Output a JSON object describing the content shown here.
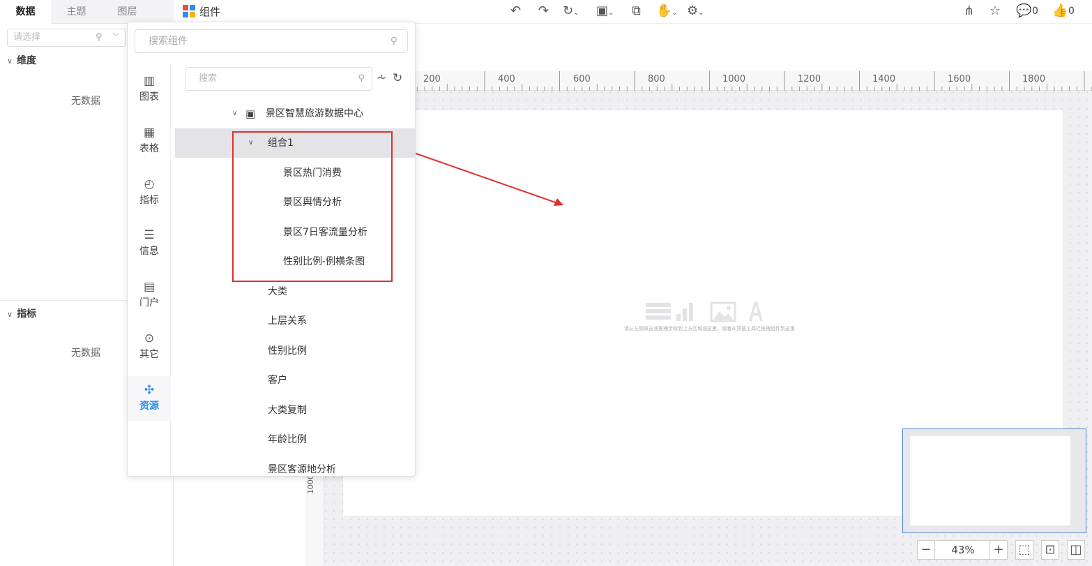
{
  "left_panel": {
    "tabs": [
      "数据",
      "主题",
      "图层"
    ],
    "select_placeholder": "请选择",
    "dimension_title": "维度",
    "dimension_empty": "无数据",
    "metric_title": "指标",
    "metric_empty": "无数据"
  },
  "toolbar": {
    "component_label": "组件",
    "comment_count": "0",
    "like_count": "0"
  },
  "popup": {
    "search_placeholder": "搜索组件",
    "inner_search_placeholder": "搜索",
    "categories": [
      {
        "label": "图表",
        "icon": "bar-chart-icon"
      },
      {
        "label": "表格",
        "icon": "table-icon"
      },
      {
        "label": "指标",
        "icon": "gauge-icon"
      },
      {
        "label": "信息",
        "icon": "info-icon"
      },
      {
        "label": "门户",
        "icon": "portal-icon"
      },
      {
        "label": "其它",
        "icon": "more-icon"
      },
      {
        "label": "资源",
        "icon": "puzzle-icon"
      }
    ],
    "active_category": "资源",
    "tree": {
      "root": "景区智慧旅游数据中心",
      "group": "组合1",
      "group_children": [
        "景区热门消费",
        "景区舆情分析",
        "景区7日客流量分析",
        "性别比例-例横条图"
      ],
      "items": [
        "大类",
        "上层关系",
        "性别比例",
        "客户",
        "大类复制",
        "年龄比例",
        "景区客源地分析"
      ]
    }
  },
  "canvas": {
    "ruler_labels": [
      "200",
      "400",
      "600",
      "800",
      "1000",
      "1200",
      "1400",
      "1600",
      "1800"
    ],
    "ruler_v_label": "1000",
    "placeholder_text": "请从左侧双击或拖拽字段到上方区域或这里，或者从顶部工具栏拖拽组件到这里",
    "zoom": "43%"
  },
  "colors": {
    "accent": "#2d8cf0",
    "highlight": "#e0302f"
  }
}
